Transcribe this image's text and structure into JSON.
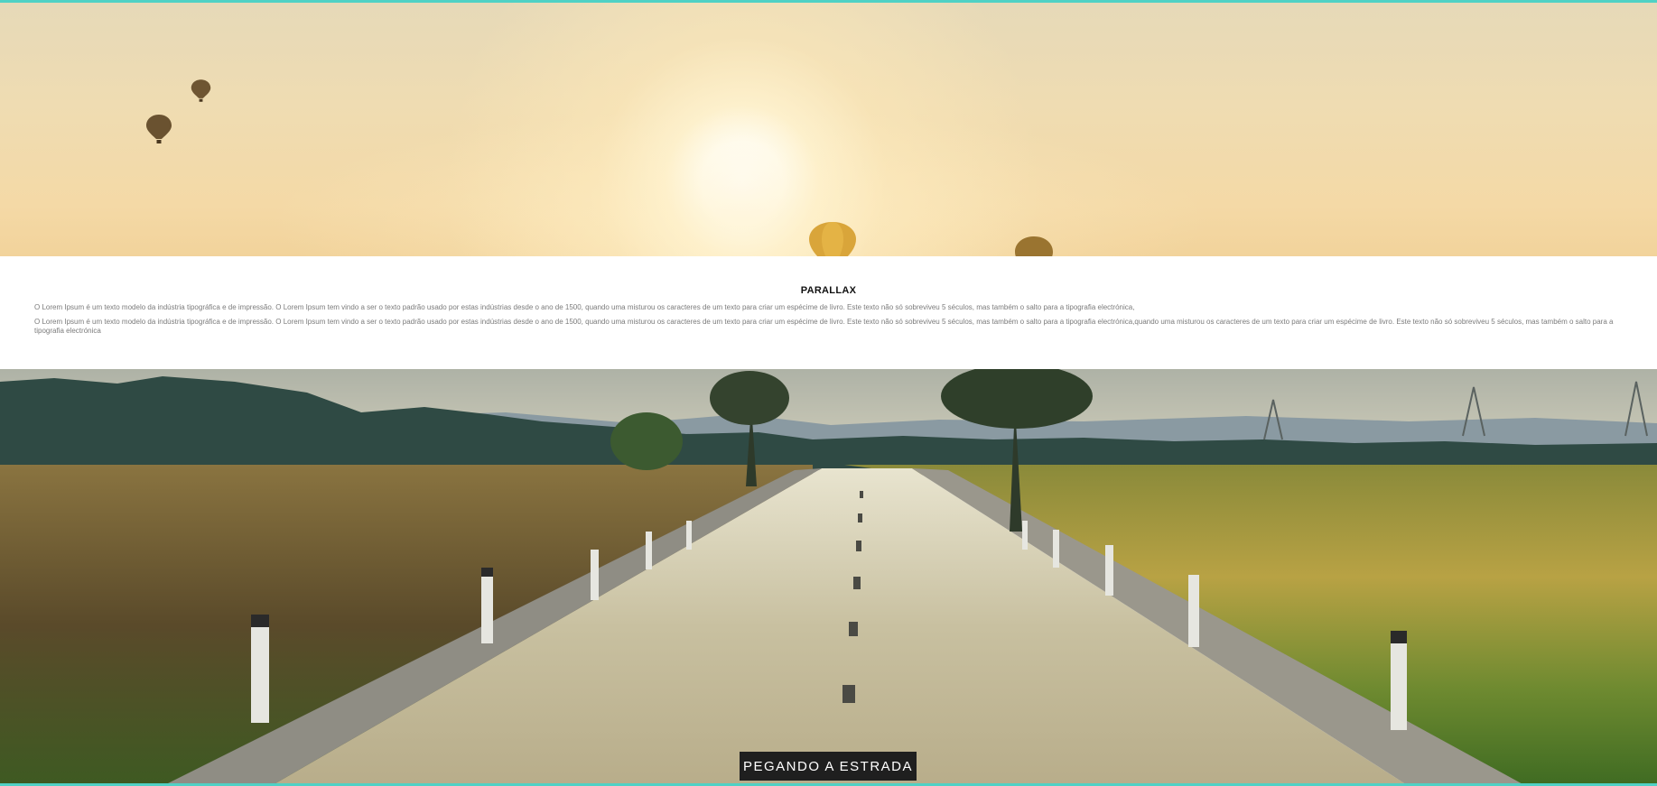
{
  "section": {
    "title": "PARALLAX",
    "paragraphs": [
      "O Lorem Ipsum é um texto modelo da indústria tipográfica e de impressão. O Lorem Ipsum tem vindo a ser o texto padrão usado por estas indústrias desde o ano de 1500, quando uma misturou os caracteres de um texto para criar um espécime de livro. Este texto não só sobreviveu 5 séculos, mas também o salto para a tipografia electrónica,",
      "O Lorem Ipsum é um texto modelo da indústria tipográfica e de impressão. O Lorem Ipsum tem vindo a ser o texto padrão usado por estas indústrias desde o ano de 1500, quando uma misturou os caracteres de um texto para criar um espécime de livro. Este texto não só sobreviveu 5 séculos, mas também o salto para a tipografia electrónica,quando uma misturou os caracteres de um texto para criar um espécime de livro. Este texto não só sobreviveu 5 séculos, mas também o salto para a tipografia electrónica"
    ]
  },
  "road_section": {
    "button_label": "PEGANDO A ESTRADA"
  },
  "colors": {
    "accent_border": "#4fd1c5",
    "button_bg": "#1f1f1f"
  },
  "icons": {
    "balloons": "hot-air-balloon-icon"
  }
}
